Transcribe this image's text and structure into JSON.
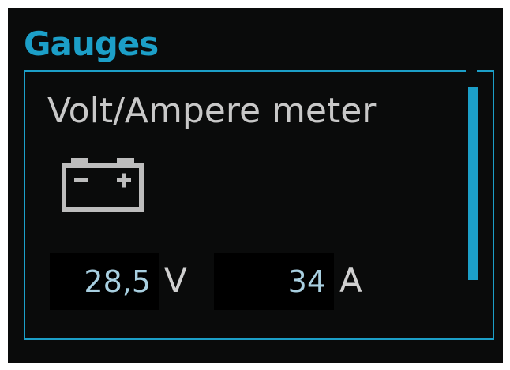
{
  "header": {
    "title": "Gauges"
  },
  "widget": {
    "title": "Volt/Ampere meter",
    "icon": "battery-icon",
    "voltage": {
      "value": "28,5",
      "unit": "V"
    },
    "current": {
      "value": "34",
      "unit": "A"
    }
  },
  "scrollbar": {
    "position": 0
  },
  "colors": {
    "accent": "#1c9fc8",
    "background": "#0a0b0b",
    "text": "#c8c8c8",
    "value": "#a8cfe0"
  }
}
